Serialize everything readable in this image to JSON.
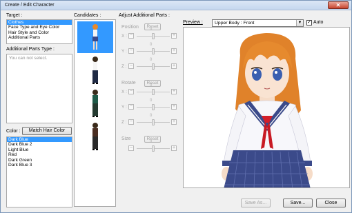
{
  "window": {
    "title": "Create / Edit Character",
    "close_icon": "close-icon"
  },
  "target": {
    "label": "Target :",
    "items": [
      "Clothes",
      "Face Type and Eye Color",
      "Hair Style and Color",
      "Additional Parts"
    ],
    "selected_index": 0
  },
  "additional_parts": {
    "label": "Additional Parts Type :",
    "placeholder": "You can not select."
  },
  "color": {
    "label": "Color :",
    "match_button": "Match Hair Color",
    "items": [
      "Dark Blue",
      "Dark Blue 2",
      "Light Blue",
      "Red",
      "Dark Green",
      "Dark Blue 3"
    ],
    "selected_index": 0
  },
  "candidates": {
    "label": "Candidates :",
    "selected_index": 0
  },
  "adjust": {
    "title": "Adjust Additional Parts :",
    "position_label": "Position",
    "rotate_label": "Rotate",
    "size_label": "Size",
    "reset_label": "Reset",
    "zero_label": "0",
    "axes": [
      "X :",
      "Y :",
      "Z :"
    ],
    "minus": "−",
    "plus": "+"
  },
  "preview": {
    "label": "Preview :",
    "view_value": "Upper Body : Front",
    "auto_label": "Auto",
    "auto_checked": true
  },
  "footer": {
    "save_as": "Save As...",
    "save": "Save...",
    "close": "Close"
  },
  "colors": {
    "accent": "#3399ff",
    "hair": "#e68a2e",
    "eyes": "#3a5fb0",
    "skirt": "#3b4a8a",
    "tie": "#d41f2a"
  }
}
